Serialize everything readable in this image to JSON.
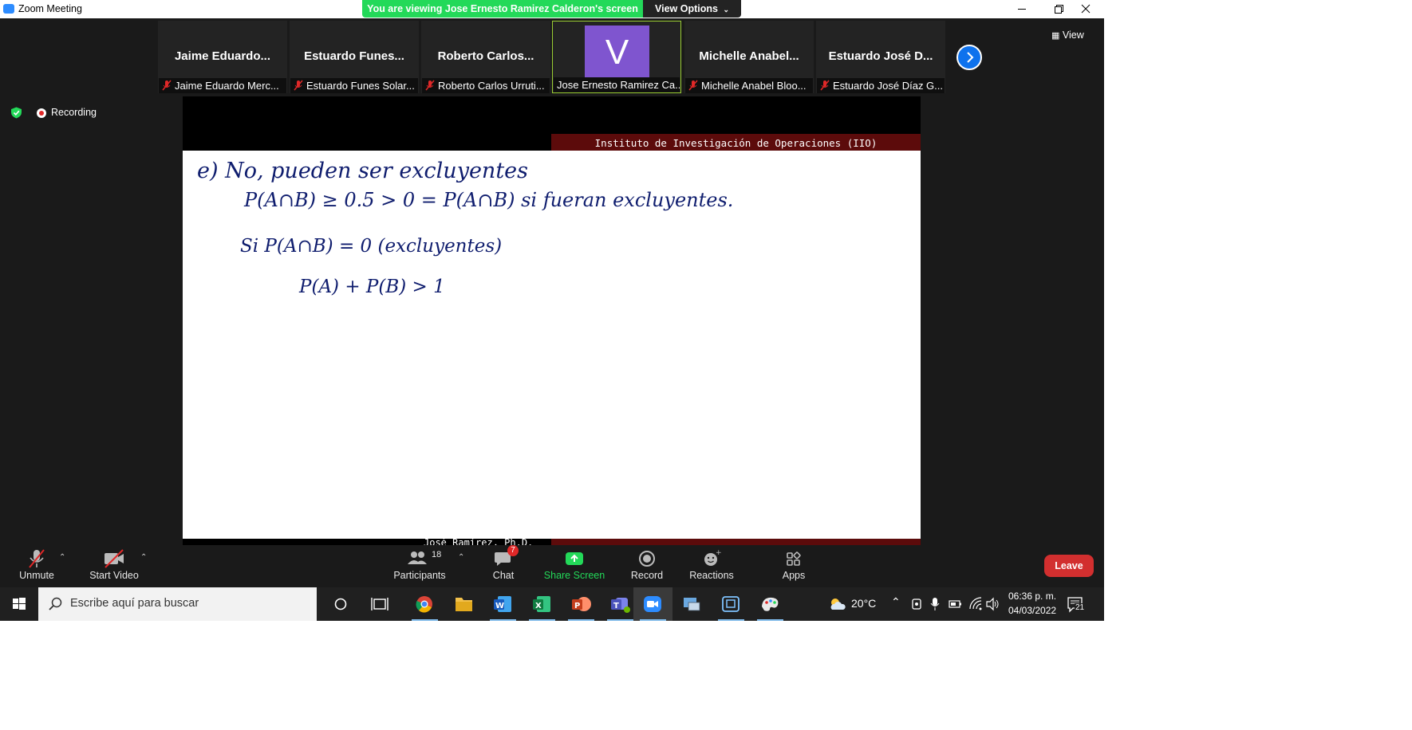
{
  "window": {
    "title": "Zoom Meeting",
    "banner": "You are viewing Jose Ernesto Ramirez Calderon's screen",
    "view_options": "View Options",
    "controls": [
      "minimize",
      "restore",
      "close"
    ]
  },
  "thumbnails": [
    {
      "name": "Jaime  Eduardo...",
      "label": "Jaime Eduardo Merc...",
      "muted": true
    },
    {
      "name": "Estuardo  Funes...",
      "label": "Estuardo Funes Solar...",
      "muted": true
    },
    {
      "name": "Roberto  Carlos...",
      "label": "Roberto Carlos Urruti...",
      "muted": true
    },
    {
      "name": "V",
      "label": "Jose Ernesto Ramirez Ca...",
      "muted": false,
      "active": true
    },
    {
      "name": "Michelle  Anabel...",
      "label": "Michelle Anabel Bloo...",
      "muted": true
    },
    {
      "name": "Estuardo José  D...",
      "label": "Estuardo José Díaz G...",
      "muted": true
    }
  ],
  "view_button": "View",
  "recording": "Recording",
  "slide": {
    "header": "Instituto de Investigación de Operaciones (IIO)",
    "footer": "José Ramírez, Ph.D.",
    "lines": [
      "e)  No, pueden  ser  excluyentes",
      "P(A∩B) ≥ 0.5  > 0 = P(A∩B)  si  fueran  excluyentes.",
      "Si    P(A∩B) = 0     (excluyentes)",
      "P(A) + P(B) > 1"
    ]
  },
  "toolbar": {
    "unmute": "Unmute",
    "start_video": "Start Video",
    "participants": "Participants",
    "participants_count": "18",
    "chat": "Chat",
    "chat_badge": "7",
    "share_screen": "Share Screen",
    "record": "Record",
    "reactions": "Reactions",
    "apps": "Apps",
    "leave": "Leave"
  },
  "taskbar": {
    "search_placeholder": "Escribe aquí para buscar",
    "weather": "20°C",
    "time": "06:36 p. m.",
    "date": "04/03/2022",
    "notifications": "21"
  },
  "colors": {
    "zoom_blue": "#0e72ed",
    "banner_green": "#23d959",
    "leave_red": "#d22f2f",
    "slide_bar": "#5c0b0b",
    "ink": "#0f1d6e",
    "avatar": "#7f55cf"
  }
}
